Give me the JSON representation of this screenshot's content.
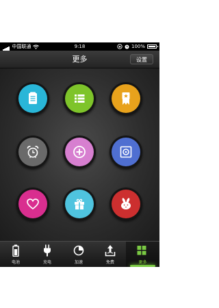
{
  "status_bar": {
    "carrier": "中国联通",
    "time": "9:18",
    "battery": "100%",
    "icons": [
      "signal-bars-icon",
      "wifi-icon",
      "orientation-lock-icon",
      "alarm-icon",
      "battery-icon"
    ]
  },
  "navbar": {
    "title": "更多",
    "settings_label": "设置"
  },
  "apps": [
    {
      "icon": "notepad-icon",
      "color": "#29b6d8"
    },
    {
      "icon": "list-icon",
      "color": "#7ec42a"
    },
    {
      "icon": "badge-ribbon-icon",
      "color": "#e8a21c"
    },
    {
      "icon": "alarm-clock-icon",
      "color": "#6a6a6a"
    },
    {
      "icon": "plus-circle-icon",
      "color": "#d77fd0"
    },
    {
      "icon": "safe-icon",
      "color": "#4f6fd1"
    },
    {
      "icon": "heart-icon",
      "color": "#d92e8f"
    },
    {
      "icon": "gift-icon",
      "color": "#4fc4df"
    },
    {
      "icon": "rabbit-icon",
      "color": "#cc2f2f"
    }
  ],
  "tabs": [
    {
      "label": "电池",
      "icon": "battery-icon"
    },
    {
      "label": "充电",
      "icon": "plug-icon"
    },
    {
      "label": "加速",
      "icon": "pie-chart-icon"
    },
    {
      "label": "免费",
      "icon": "download-tray-icon"
    },
    {
      "label": "更多",
      "icon": "grid-icon",
      "active": true
    }
  ],
  "colors": {
    "accent": "#7ac943",
    "navbar": "#2f2f2f",
    "background": "#161616"
  }
}
